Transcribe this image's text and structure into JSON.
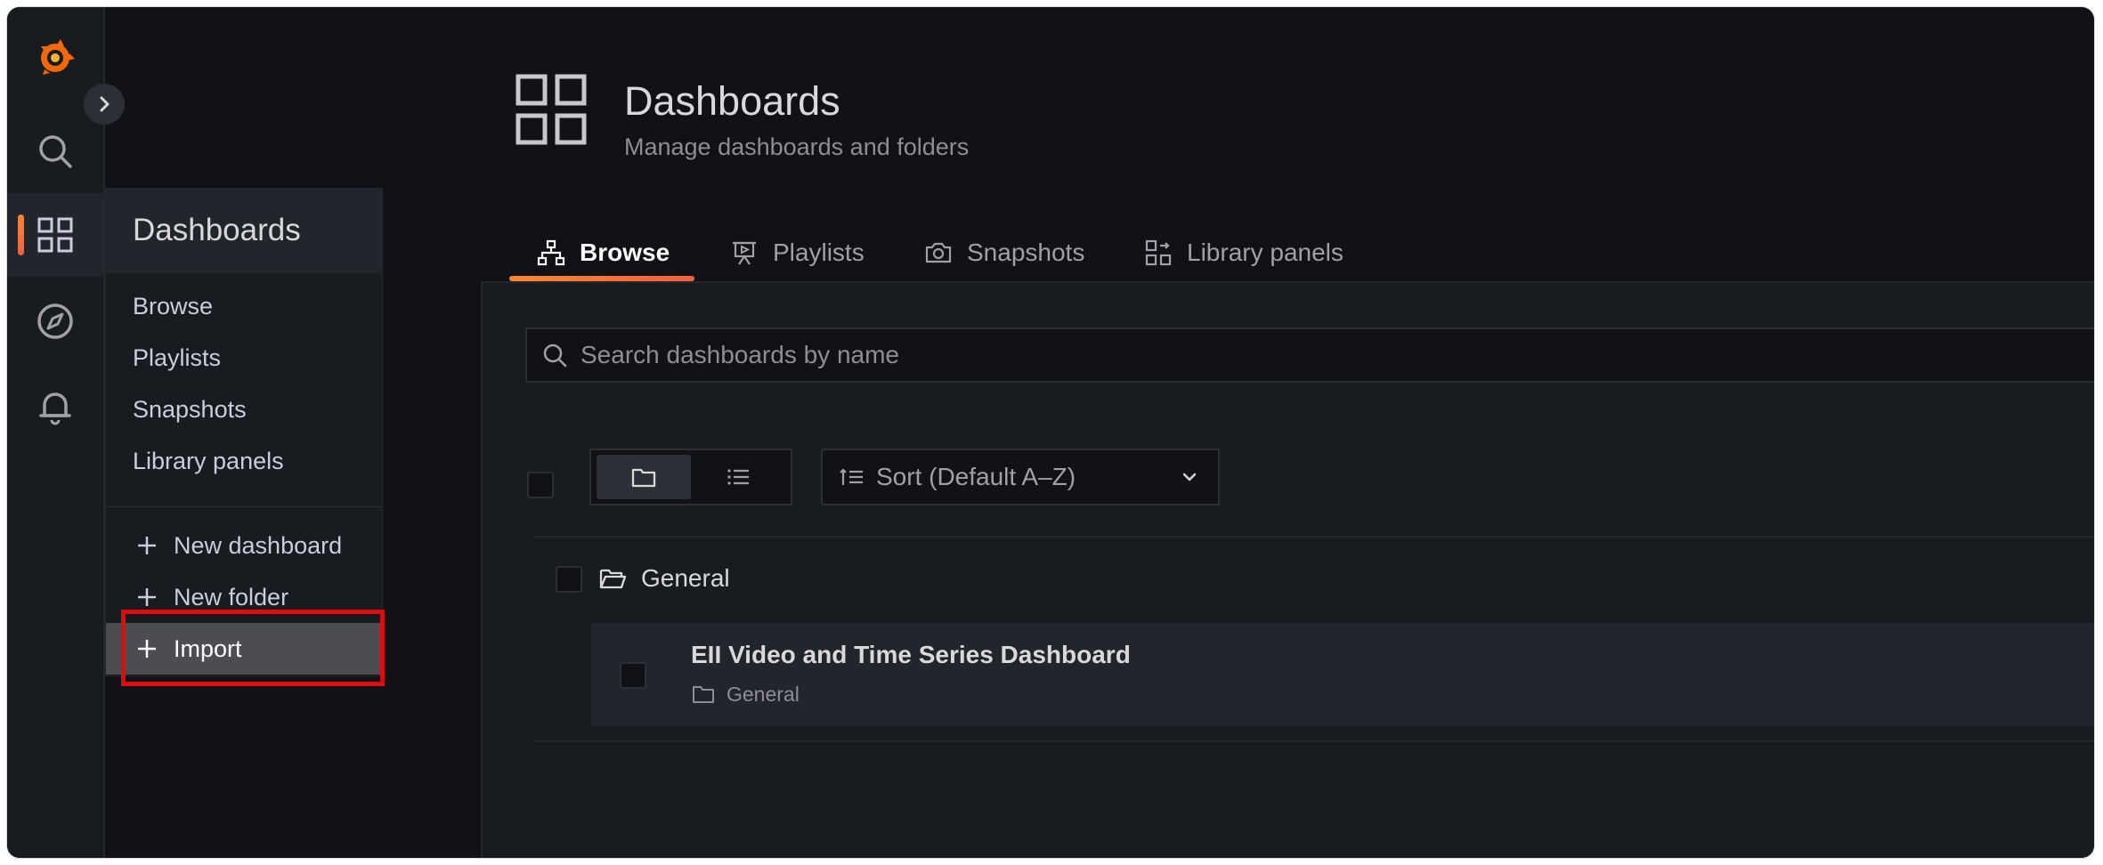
{
  "page": {
    "title": "Dashboards",
    "subtitle": "Manage dashboards and folders"
  },
  "nav_rail": {
    "items": [
      "grafana-logo",
      "search-icon",
      "dashboards-icon",
      "explore-icon",
      "alerting-icon"
    ],
    "active": "dashboards-icon"
  },
  "flyout": {
    "title": "Dashboards",
    "links": [
      "Browse",
      "Playlists",
      "Snapshots",
      "Library panels"
    ],
    "actions": [
      "New dashboard",
      "New folder",
      "Import"
    ],
    "selected_action": "Import"
  },
  "tabs": [
    {
      "label": "Browse",
      "icon": "sitemap-icon",
      "active": true
    },
    {
      "label": "Playlists",
      "icon": "presentation-icon",
      "active": false
    },
    {
      "label": "Snapshots",
      "icon": "camera-icon",
      "active": false
    },
    {
      "label": "Library panels",
      "icon": "library-panel-icon",
      "active": false
    }
  ],
  "search": {
    "placeholder": "Search dashboards by name",
    "value": ""
  },
  "sort": {
    "label": "Sort (Default A–Z)"
  },
  "folders": [
    {
      "name": "General",
      "dashboards": [
        {
          "title": "EII Video and Time Series Dashboard",
          "folder": "General"
        }
      ]
    }
  ],
  "colors": {
    "accent": "#ff8833",
    "background": "#111217",
    "highlight_box": "#e00b0b"
  }
}
